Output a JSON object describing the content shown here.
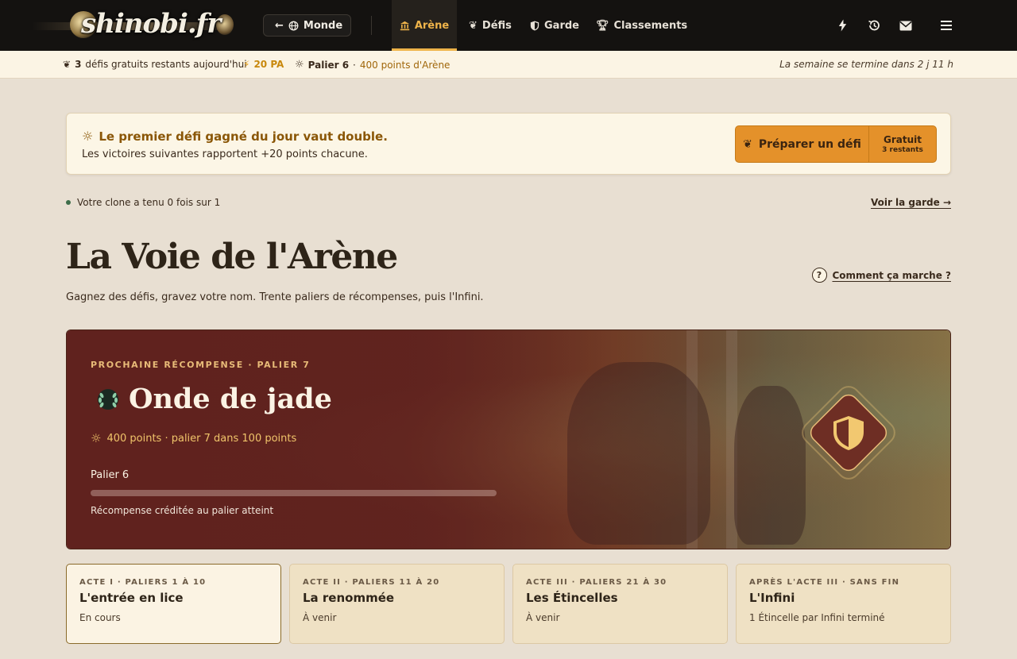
{
  "logo": {
    "text": "shinobi.fr"
  },
  "topnav": {
    "world_button": "Monde",
    "tabs": [
      {
        "label": "Arène",
        "icon": "temple-icon",
        "active": true
      },
      {
        "label": "Défis",
        "icon": "lotus-icon",
        "active": false
      },
      {
        "label": "Garde",
        "icon": "shield-icon",
        "active": false
      },
      {
        "label": "Classements",
        "icon": "trophy-icon",
        "active": false
      }
    ],
    "icons": [
      "lightning-icon",
      "history-icon",
      "mail-icon",
      "menu-icon"
    ]
  },
  "statusbar": {
    "free_count": "3",
    "free_text": "défis gratuits restants aujourd'hui",
    "pa": "20 PA",
    "tier": "Palier 6",
    "separator": "·",
    "points": "400 points d'Arène",
    "week_end": "La semaine se termine dans 2 j 11 h"
  },
  "banner": {
    "title": "Le premier défi gagné du jour vaut double.",
    "subtitle": "Les victoires suivantes rapportent +20 points chacune.",
    "cta_label": "Préparer un défi",
    "cta_side_title": "Gratuit",
    "cta_side_sub": "3 restants"
  },
  "clone": {
    "text": "Votre clone a tenu 0 fois sur 1",
    "guard_link": "Voir la garde →"
  },
  "page": {
    "title": "La Voie de l'Arène",
    "subtitle": "Gagnez des défis, gravez votre nom. Trente paliers de récompenses, puis l'Infini.",
    "help_symbol": "?",
    "help_link": "Comment ça marche ?"
  },
  "hero": {
    "kicker": "PROCHAINE RÉCOMPENSE · PALIER 7",
    "title": "Onde de jade",
    "points": "400 points · palier 7 dans 100 points",
    "tier": "Palier 6",
    "progress": 0,
    "note": "Récompense créditée au palier atteint"
  },
  "acts": [
    {
      "kicker": "ACTE I · PALIERS 1 À 10",
      "title": "L'entrée en lice",
      "status": "En cours",
      "current": true
    },
    {
      "kicker": "ACTE II · PALIERS 11 À 20",
      "title": "La renommée",
      "status": "À venir",
      "current": false
    },
    {
      "kicker": "ACTE III · PALIERS 21 À 30",
      "title": "Les Étincelles",
      "status": "À venir",
      "current": false
    },
    {
      "kicker": "APRÈS L'ACTE III · SANS FIN",
      "title": "L'Infini",
      "status": "1 Étincelle par Infini terminé",
      "current": false
    }
  ],
  "colors": {
    "accent": "#efb44a",
    "cta": "#e4912a",
    "hero": "#60221e",
    "jade": "#3e6d4a"
  }
}
